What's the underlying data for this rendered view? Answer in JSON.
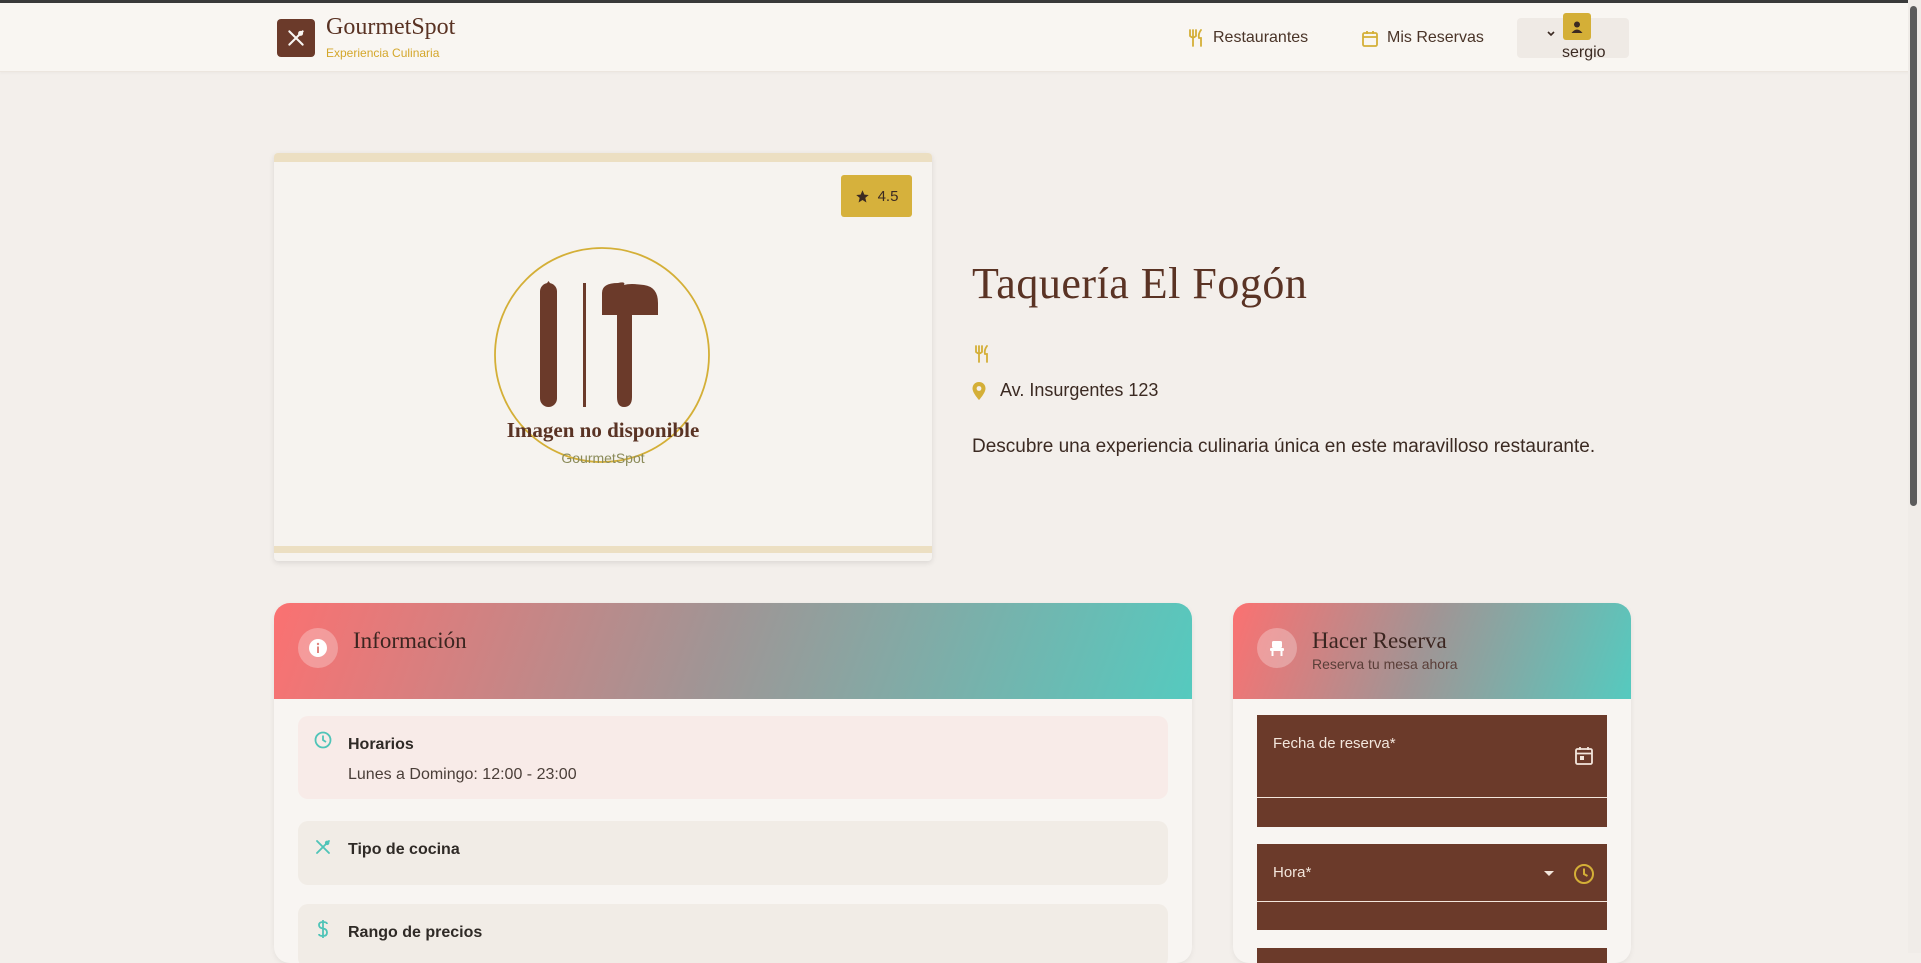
{
  "header": {
    "brand_name": "GourmetSpot",
    "brand_subtitle": "Experiencia Culinaria",
    "nav": [
      {
        "label": "Restaurantes",
        "icon": "utensils-icon"
      },
      {
        "label": "Mis Reservas",
        "icon": "calendar-icon"
      }
    ],
    "user": {
      "name": "sergio",
      "icon": "user-icon"
    }
  },
  "restaurant": {
    "rating": "4.5",
    "image_placeholder_title": "Imagen no disponible",
    "image_placeholder_sub": "GourmetSpot",
    "name": "Taquería El Fogón",
    "address": "Av. Insurgentes 123",
    "description": "Descubre una experiencia culinaria única en este maravilloso restaurante."
  },
  "info": {
    "title": "Información",
    "rows": [
      {
        "title": "Horarios",
        "text": "Lunes a Domingo: 12:00 - 23:00",
        "icon": "clock-icon"
      },
      {
        "title": "Tipo de cocina",
        "text": "",
        "icon": "utensils-crossed-icon"
      },
      {
        "title": "Rango de precios",
        "text": "",
        "icon": "dollar-icon"
      }
    ]
  },
  "reservation": {
    "title": "Hacer Reserva",
    "subtitle": "Reserva tu mesa ahora",
    "fields": [
      {
        "label": "Fecha de reserva*",
        "icon": "calendar-icon"
      },
      {
        "label": "Hora*",
        "icon": "clock-icon"
      }
    ]
  },
  "colors": {
    "brand": "#6b3a2a",
    "accent": "#d4af37",
    "gradient_start": "#fb7171",
    "gradient_end": "#55cabf"
  }
}
